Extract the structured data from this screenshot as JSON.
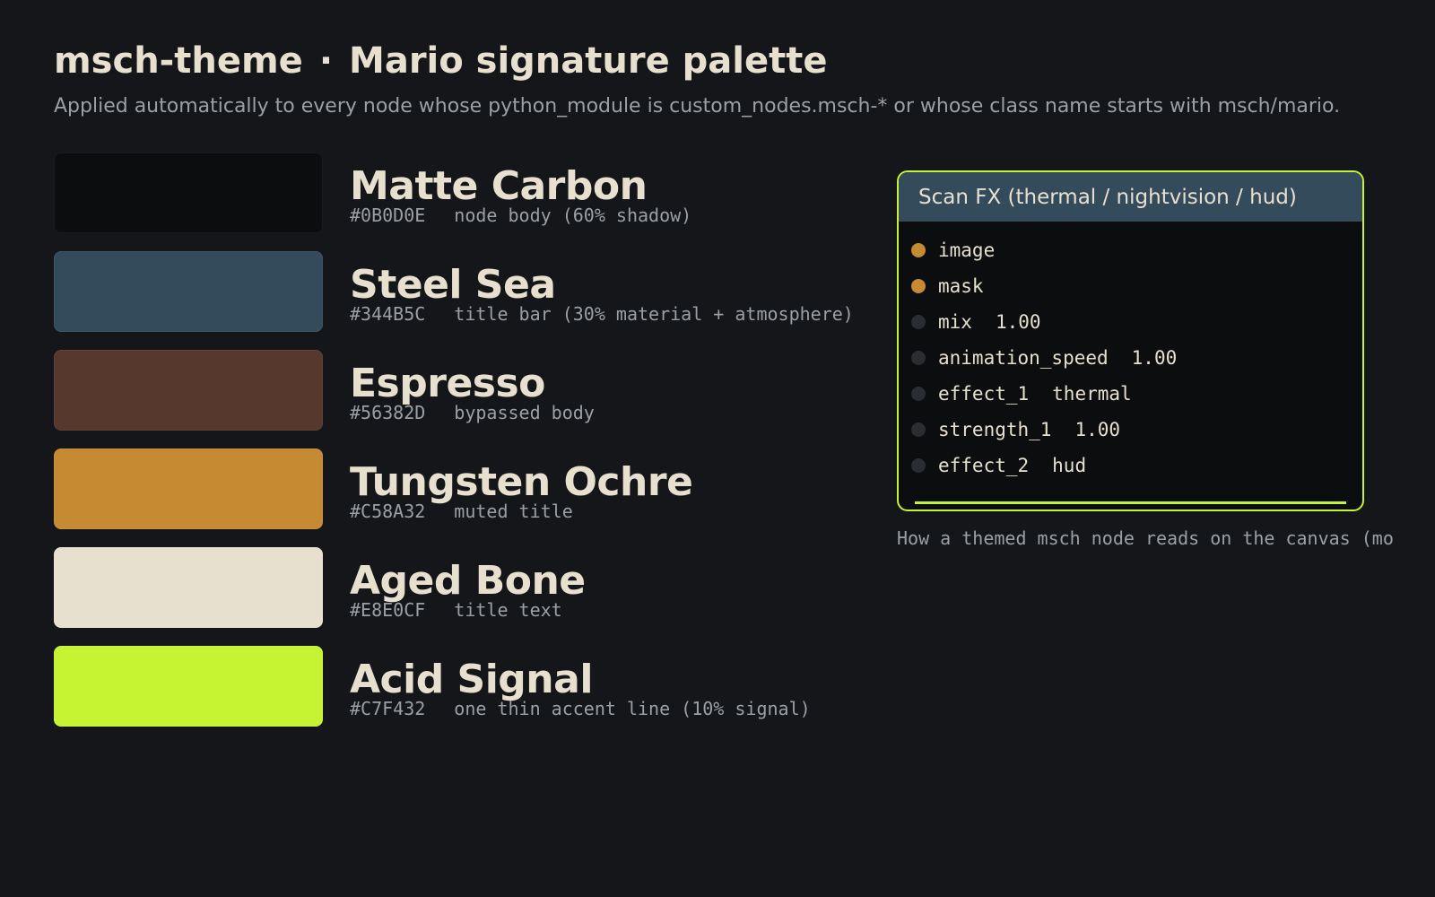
{
  "header": {
    "theme_name": "msch-theme",
    "separator": "·",
    "palette_name": "Mario signature palette",
    "subtitle": "Applied automatically to every node whose python_module is custom_nodes.msch-* or whose class name starts with msch/mario."
  },
  "palette": [
    {
      "name": "Matte Carbon",
      "hex": "#0B0D0E",
      "role": "node body (60% shadow)",
      "color": "#0B0D0E"
    },
    {
      "name": "Steel Sea",
      "hex": "#344B5C",
      "role": "title bar (30% material + atmosphere)",
      "color": "#344B5C"
    },
    {
      "name": "Espresso",
      "hex": "#56382D",
      "role": "bypassed body",
      "color": "#56382D"
    },
    {
      "name": "Tungsten Ochre",
      "hex": "#C58A32",
      "role": "muted title",
      "color": "#C58A32"
    },
    {
      "name": "Aged Bone",
      "hex": "#E8E0CF",
      "role": "title text",
      "color": "#E8E0CF"
    },
    {
      "name": "Acid Signal",
      "hex": "#C7F432",
      "role": "one thin accent line (10% signal)",
      "color": "#C7F432"
    }
  ],
  "node_preview": {
    "title": "Scan FX (thermal / nightvision / hud)",
    "slots": [
      {
        "name": "image",
        "value": "",
        "kind": "input"
      },
      {
        "name": "mask",
        "value": "",
        "kind": "input"
      },
      {
        "name": "mix",
        "value": "1.00",
        "kind": "widget"
      },
      {
        "name": "animation_speed",
        "value": "1.00",
        "kind": "widget"
      },
      {
        "name": "effect_1",
        "value": "thermal",
        "kind": "widget"
      },
      {
        "name": "strength_1",
        "value": "1.00",
        "kind": "widget"
      },
      {
        "name": "effect_2",
        "value": "hud",
        "kind": "widget"
      }
    ],
    "caption": "How a themed msch node reads on the canvas (mo"
  },
  "colors": {
    "background": "#141619",
    "muted_text": "#9AA0A6",
    "input_slot": "#C58A32",
    "widget_slot": "#2A2D31"
  }
}
